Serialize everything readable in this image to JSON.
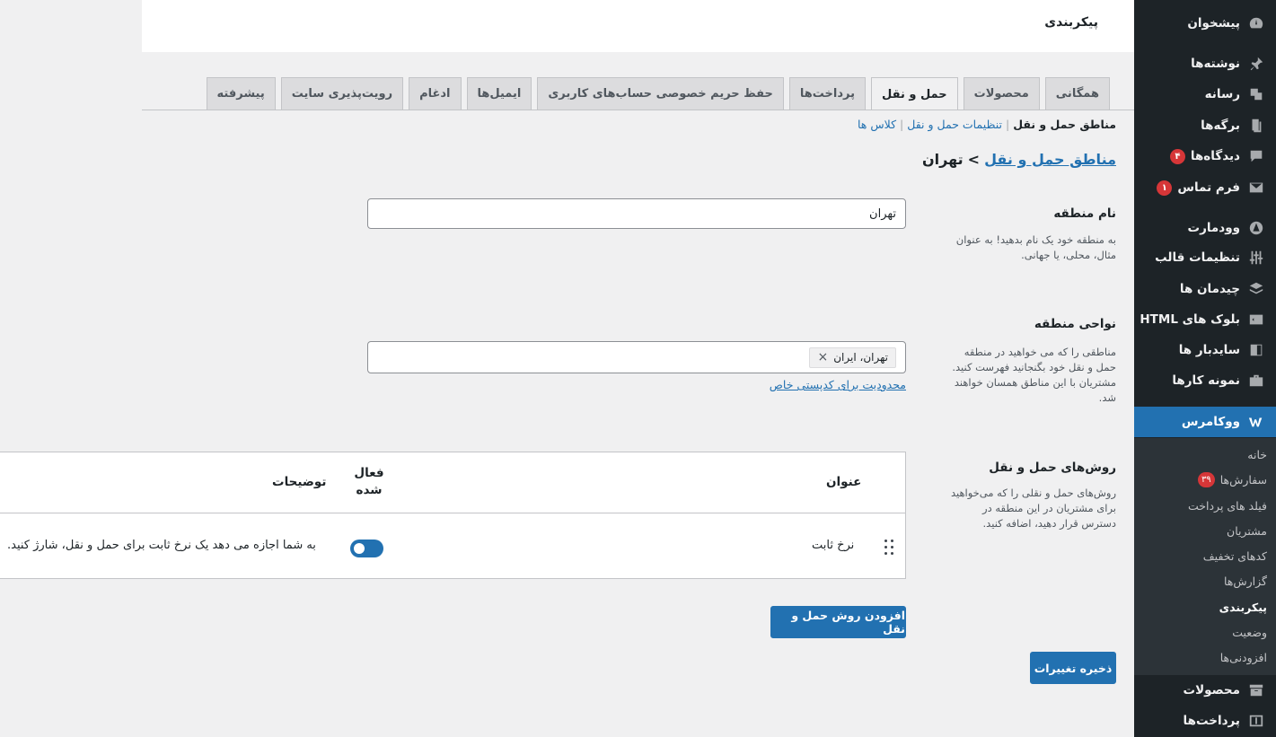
{
  "sidebar": {
    "items": [
      {
        "label": "پیشخوان",
        "icon": "dashboard-icon"
      },
      {
        "label": "نوشته‌ها",
        "icon": "pin-icon"
      },
      {
        "label": "رسانه",
        "icon": "media-icon"
      },
      {
        "label": "برگه‌ها",
        "icon": "pages-icon"
      },
      {
        "label": "دیدگاه‌ها",
        "icon": "comments-icon",
        "badge": "۴"
      },
      {
        "label": "فرم تماس",
        "icon": "mail-icon",
        "badge": "۱"
      },
      {
        "label": "وودمارت",
        "icon": "woodmart-icon"
      },
      {
        "label": "تنظیمات قالب",
        "icon": "sliders-icon"
      },
      {
        "label": "چیدمان ها",
        "icon": "layers-icon"
      },
      {
        "label": "بلوک های HTML",
        "icon": "html-block-icon"
      },
      {
        "label": "سایدبار ها",
        "icon": "sidebar-icon"
      },
      {
        "label": "نمونه کارها",
        "icon": "portfolio-icon"
      },
      {
        "label": "ووکامرس",
        "icon": "woocommerce-icon"
      },
      {
        "label": "محصولات",
        "icon": "archive-icon"
      },
      {
        "label": "پرداخت‌ها",
        "icon": "payments-icon"
      }
    ],
    "submenu": [
      {
        "label": "خانه"
      },
      {
        "label": "سفارش‌ها",
        "badge": "۳۹"
      },
      {
        "label": "فیلد های پرداخت"
      },
      {
        "label": "مشتریان"
      },
      {
        "label": "کدهای تخفیف"
      },
      {
        "label": "گزارش‌ها"
      },
      {
        "label": "پیکربندی"
      },
      {
        "label": "وضعیت"
      },
      {
        "label": "افزودنی‌ها"
      }
    ]
  },
  "header": {
    "title": "پیکربندی"
  },
  "tabs": [
    "همگانی",
    "محصولات",
    "حمل و نقل",
    "پرداخت‌ها",
    "حفظ حریم خصوصی حساب‌های کاربری",
    "ایمیل‌ها",
    "ادغام",
    "رویت‌پذیری سایت",
    "پیشرفته"
  ],
  "subnav": {
    "current": "مناطق حمل و نقل",
    "link1": "تنظیمات حمل و نقل",
    "link2": "کلاس ها"
  },
  "breadcrumb": {
    "link": "مناطق حمل و نقل",
    "current": "تهران"
  },
  "zone_name": {
    "label": "نام منطقه",
    "desc": "به منطقه خود یک نام بدهید! به عنوان مثال، محلی، یا جهانی.",
    "value": "تهران"
  },
  "zone_regions": {
    "label": "نواحی منطقه",
    "desc": "مناطقی را که می خواهید در منطقه حمل و نقل خود بگنجانید فهرست کنید. مشتریان با این مناطق همسان خواهند شد.",
    "chip": "تهران، ایران",
    "chip_remove": "×",
    "postcode_link": "محدودیت برای کدپستی خاص"
  },
  "shipping_methods": {
    "label": "روش‌های حمل و نقل",
    "desc": "روش‌های حمل و نقلی را که می‌خواهید برای مشتریان در این منطقه در دسترس قرار دهید، اضافه کنید.",
    "columns": {
      "title": "عنوان",
      "enabled": "فعال شده",
      "description": "توضیحات"
    },
    "rows": [
      {
        "title": "نرخ ثابت",
        "enabled": true,
        "description": "به شما اجازه می دهد یک نرخ ثابت برای حمل و نقل، شارژ کنید."
      }
    ],
    "add_button": "افزودن روش حمل و نقل"
  },
  "save_button": "ذخیره تغییرات",
  "colors": {
    "accent": "#2271b1",
    "sidebar": "#1d2327",
    "badge": "#d63638"
  }
}
